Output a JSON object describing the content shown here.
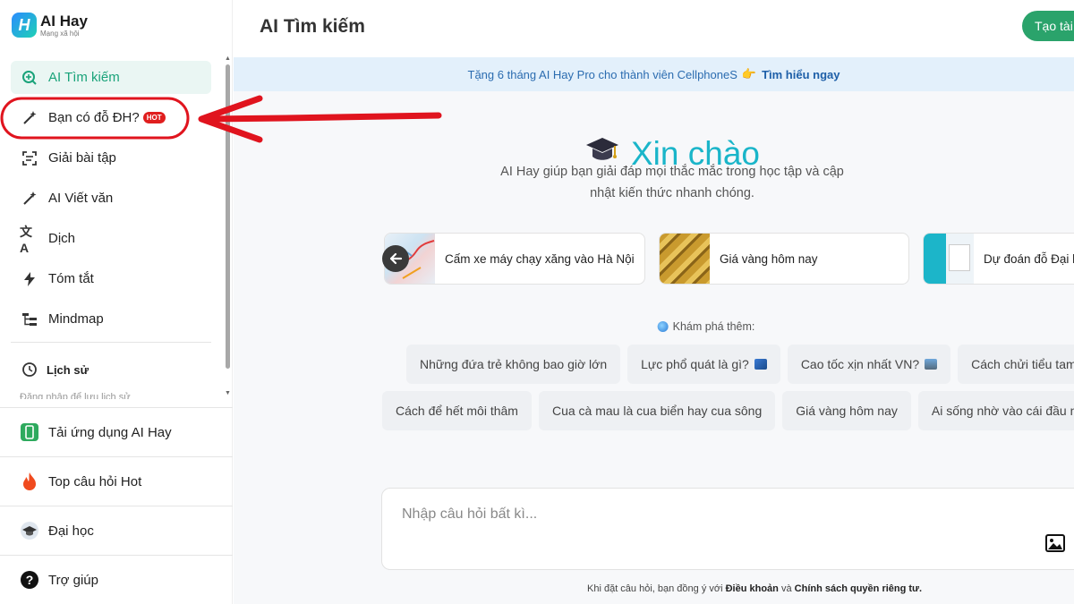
{
  "app": {
    "logo_title": "AI Hay",
    "logo_sub": "Mạng xã hội",
    "logo_letter": "H"
  },
  "sidebar": {
    "items": [
      {
        "label": "AI Tìm kiếm",
        "icon": "search-plus-icon",
        "active": true
      },
      {
        "label": "Bạn có đỗ ĐH?",
        "icon": "magic-wand-icon",
        "badge": "HOT"
      },
      {
        "label": "Giải bài tập",
        "icon": "scan-text-icon"
      },
      {
        "label": "AI Viết văn",
        "icon": "magic-wand-icon"
      },
      {
        "label": "Dịch",
        "icon": "translate-icon"
      },
      {
        "label": "Tóm tắt",
        "icon": "lightning-icon"
      },
      {
        "label": "Mindmap",
        "icon": "mindmap-icon"
      }
    ],
    "history_label": "Lịch sử",
    "history_faded": "Đăng nhập để lưu lịch sử",
    "bottom": [
      {
        "label": "Tải ứng dụng AI Hay",
        "icon": "phone-icon"
      },
      {
        "label": "Top câu hỏi Hot",
        "icon": "fire-icon"
      },
      {
        "label": "Đại học",
        "icon": "graduation-cap-icon"
      },
      {
        "label": "Trợ giúp",
        "icon": "help-icon"
      }
    ]
  },
  "header": {
    "title": "AI Tìm kiếm",
    "create_label": "Tạo tài"
  },
  "banner": {
    "text": "Tặng 6 tháng AI Hay Pro cho thành viên CellphoneS",
    "link": "Tìm hiểu ngay"
  },
  "hero": {
    "greeting": "Xin chào",
    "description": "AI Hay giúp bạn giải đáp mọi thắc mắc trong học tập và cập nhật kiến thức nhanh chóng."
  },
  "cards": [
    {
      "label": "Cấm xe máy chạy xăng vào Hà Nội"
    },
    {
      "label": "Giá vàng hôm nay"
    },
    {
      "label": "Dự đoán đỗ Đại h"
    }
  ],
  "explore_label": "Khám phá thêm:",
  "chips_row1": [
    "Những đứa trẻ không bao giờ lớn",
    "Lực phổ quát là gì?",
    "Cao tốc xịn nhất VN?",
    "Cách chửi tiểu tam"
  ],
  "chips_row2": [
    "Cách để hết môi thâm",
    "Cua cà mau là cua biển hay cua sông",
    "Giá vàng hôm nay",
    "Ai sống nhờ vào cái đầu ngu"
  ],
  "input": {
    "placeholder": "Nhập câu hỏi bất kì..."
  },
  "terms": {
    "prefix": "Khi đặt câu hỏi, bạn đồng ý với",
    "link1": "Điều khoản",
    "and": "và",
    "link2": "Chính sách quyền riêng tư",
    "suffix": "."
  },
  "colors": {
    "accent": "#1aa37a",
    "brand_cyan": "#1ab5c9",
    "annotation_red": "#e0141e"
  }
}
